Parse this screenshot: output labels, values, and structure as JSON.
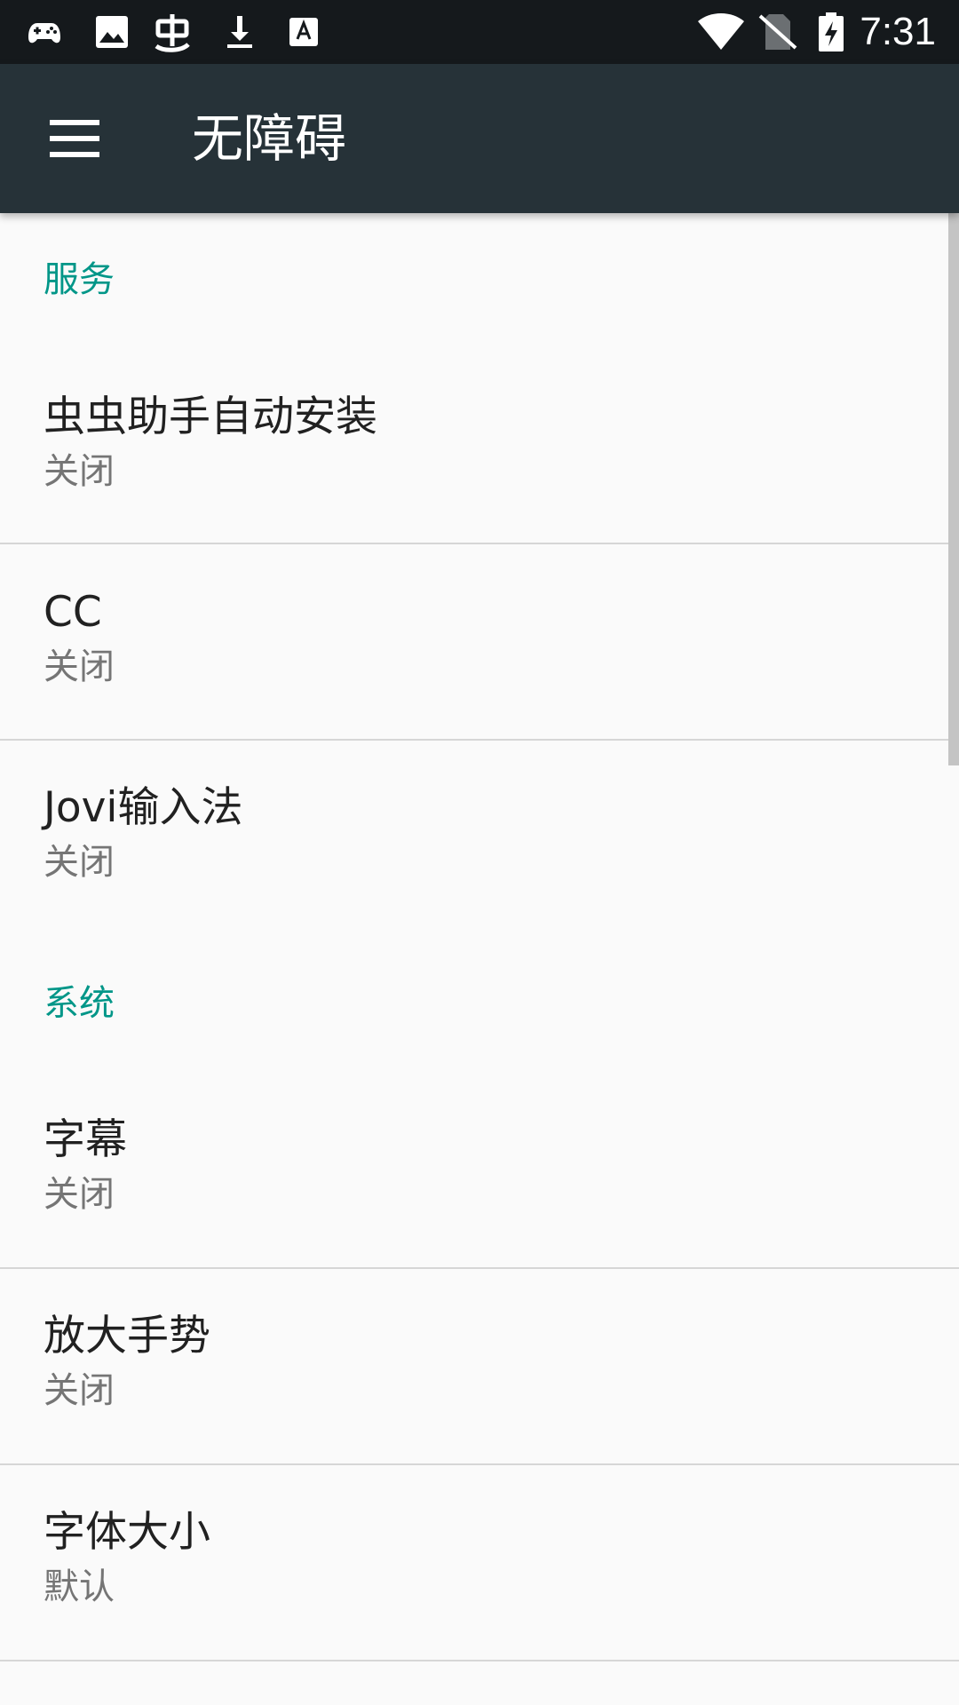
{
  "status_bar": {
    "time": "7:31",
    "left_icons": [
      "game-controller-icon",
      "image-icon",
      "chongchong-app-icon",
      "download-icon",
      "keyboard-a-icon"
    ],
    "right_icons": [
      "wifi-icon",
      "no-sim-icon",
      "battery-charging-icon"
    ]
  },
  "app_bar": {
    "title": "无障碍",
    "menu_icon": "hamburger-menu-icon"
  },
  "sections": {
    "services": {
      "header": "服务",
      "items": [
        {
          "title": "虫虫助手自动安装",
          "summary": "关闭"
        },
        {
          "title": "CC",
          "summary": "关闭"
        },
        {
          "title": "Jovi输入法",
          "summary": "关闭"
        }
      ]
    },
    "system": {
      "header": "系统",
      "items": [
        {
          "title": "字幕",
          "summary": "关闭"
        },
        {
          "title": "放大手势",
          "summary": "关闭"
        },
        {
          "title": "字体大小",
          "summary": "默认"
        }
      ]
    }
  },
  "colors": {
    "status_bar": "#15191c",
    "app_bar": "#263238",
    "accent": "#009688",
    "background": "#fafafa",
    "primary_text": "#212121",
    "secondary_text": "#757575"
  }
}
